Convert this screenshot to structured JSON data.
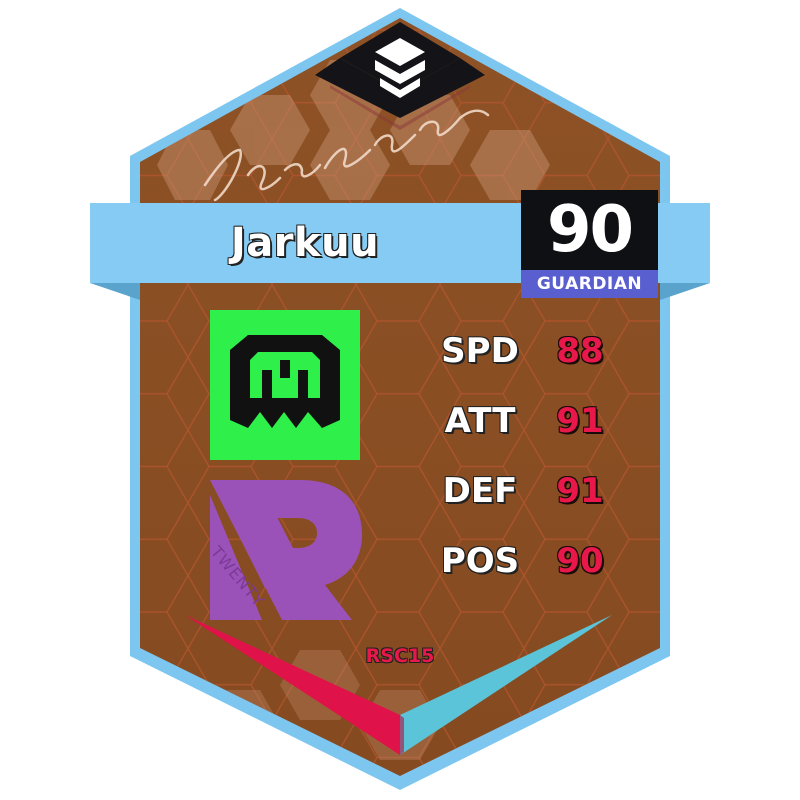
{
  "card": {
    "player_name": "Jarkuu",
    "rating": "90",
    "role": "GUARDIAN",
    "tag": "RSC15",
    "signature": "Jarkuu",
    "team_logo_icon": "green-castle-logo-icon",
    "org_logo_icon": "twenty-r-logo-icon",
    "org_logo_text": "TWENTY",
    "top_emblem_icon": "stacked-chevrons-icon",
    "colors": {
      "border": "#7cc6f0",
      "background": "#8a4e22",
      "name_bar": "#85cbf4",
      "rating_box": "#0e1014",
      "role_box": "#5a5fd0",
      "stat_value": "#e8184a",
      "team_logo_bg": "#2ff04a",
      "org_logo": "#9b52b8",
      "wing_left": "#e0124a",
      "wing_right": "#5bc4d8"
    }
  },
  "stats": [
    {
      "label": "SPD",
      "value": "88"
    },
    {
      "label": "ATT",
      "value": "91"
    },
    {
      "label": "DEF",
      "value": "91"
    },
    {
      "label": "POS",
      "value": "90"
    }
  ]
}
